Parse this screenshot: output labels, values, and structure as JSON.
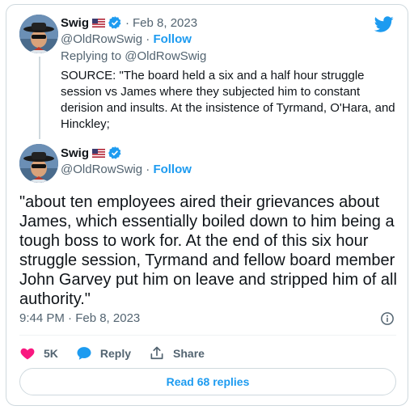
{
  "reply_tweet": {
    "display_name": "Swig",
    "handle": "@OldRowSwig",
    "follow_label": "Follow",
    "date": "Feb 8, 2023",
    "replying_to": "Replying to @OldRowSwig",
    "text": "SOURCE: \"The board held a six and a half hour struggle session vs James where they subjected him to constant derision and insults.  At the insistence of Tyrmand, O'Hara, and Hinckley;"
  },
  "main_tweet": {
    "display_name": "Swig",
    "handle": "@OldRowSwig",
    "follow_label": "Follow",
    "text": "\"about ten employees aired their grievances about James, which essentially boiled down to him being a tough boss to work for.  At the end of this six hour struggle session, Tyrmand and fellow board member John Garvey put him on leave and stripped him of all authority.\"",
    "timestamp": "9:44 PM · Feb 8, 2023"
  },
  "actions": {
    "likes": "5K",
    "reply_label": "Reply",
    "share_label": "Share"
  },
  "read_replies_label": "Read 68 replies",
  "colors": {
    "accent": "#1d9bf0",
    "like": "#f91880",
    "secondary_text": "#536471"
  },
  "icons": {
    "logo": "twitter-bird-icon",
    "verified": "verified-badge-icon",
    "flag": "us-flag-icon",
    "info": "info-icon",
    "like": "heart-icon",
    "reply": "speech-bubble-icon",
    "share": "share-icon"
  }
}
